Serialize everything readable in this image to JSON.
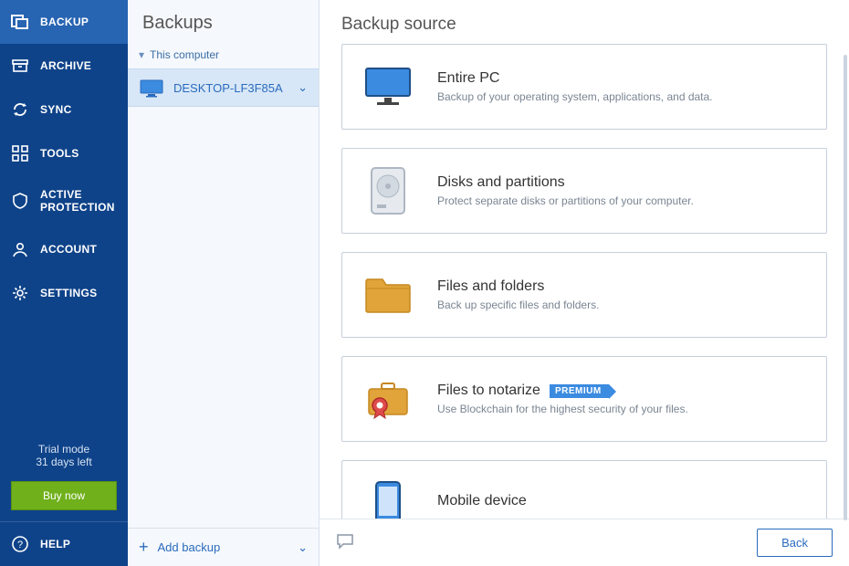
{
  "sidebar": {
    "items": [
      {
        "label": "BACKUP"
      },
      {
        "label": "ARCHIVE"
      },
      {
        "label": "SYNC"
      },
      {
        "label": "TOOLS"
      },
      {
        "label": "ACTIVE PROTECTION"
      },
      {
        "label": "ACCOUNT"
      },
      {
        "label": "SETTINGS"
      }
    ],
    "trial_line1": "Trial mode",
    "trial_line2": "31 days left",
    "buy": "Buy now",
    "help": "HELP"
  },
  "backups": {
    "title": "Backups",
    "group": "This computer",
    "selected": "DESKTOP-LF3F85A",
    "add": "Add backup"
  },
  "main": {
    "title": "Backup source",
    "cards": [
      {
        "title": "Entire PC",
        "desc": "Backup of your operating system, applications, and data."
      },
      {
        "title": "Disks and partitions",
        "desc": "Protect separate disks or partitions of your computer."
      },
      {
        "title": "Files and folders",
        "desc": "Back up specific files and folders."
      },
      {
        "title": "Files to notarize",
        "desc": "Use Blockchain for the highest security of your files.",
        "badge": "PREMIUM"
      },
      {
        "title": "Mobile device",
        "desc": ""
      }
    ],
    "back": "Back"
  }
}
